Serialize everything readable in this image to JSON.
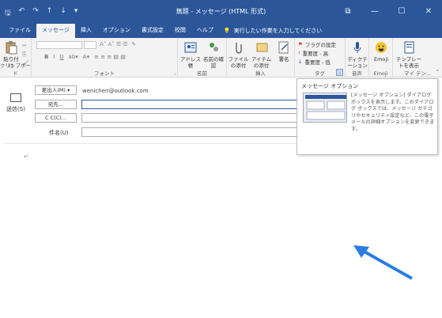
{
  "window": {
    "title": "無題 - メッセージ (HTML 形式)",
    "qa_icons": [
      "save-icon",
      "undo-icon",
      "redo-icon",
      "up-icon",
      "down-icon",
      "more-icon"
    ],
    "controls": {
      "restore": "⧉",
      "minimize": "—",
      "maximize": "☐",
      "close": "✕"
    }
  },
  "tabs": [
    {
      "label": "ファイル",
      "active": false
    },
    {
      "label": "メッセージ",
      "active": true
    },
    {
      "label": "挿入",
      "active": false
    },
    {
      "label": "オプション",
      "active": false
    },
    {
      "label": "書式設定",
      "active": false
    },
    {
      "label": "校閲",
      "active": false
    },
    {
      "label": "ヘルプ",
      "active": false
    }
  ],
  "tellme": "実行したい作業を入力してください",
  "ribbon": {
    "clipboard": {
      "paste": "貼り付け",
      "label": "クリップボード"
    },
    "font": {
      "label": "フォント",
      "bold": "B",
      "italic": "I",
      "underline": "U"
    },
    "names": {
      "address_book": "アドレス帳",
      "check_names": "名前の確認",
      "label": "名前"
    },
    "include": {
      "attach_file": "ファイルの添付",
      "attach_item": "アイテムの添付",
      "signature": "署名",
      "label": "挿入"
    },
    "tags": {
      "followup": "フラグの設定",
      "high": "重要度 - 高",
      "low": "重要度 - 低",
      "label": "タグ"
    },
    "voice": {
      "dictate": "ディクテーション",
      "label": "音声"
    },
    "emoji": {
      "emoji": "Emoji",
      "label": "Emoji"
    },
    "templates": {
      "view": "テンプレートを表示",
      "label": "マイ テン..."
    }
  },
  "tooltip": {
    "title": "メッセージ オプション",
    "desc": "[メッセージ オプション] ダイアログ ボックスを表示します。このダイアログ ボックスでは、メッセージ カテゴリやセキュリティ設定など、この電子メールの詳細オプションを変更できます。"
  },
  "compose": {
    "send": "送信(S)",
    "from_button": "差出人(M) ▾",
    "from_address": "wenichen@outlook.com",
    "to_button": "宛先...",
    "cc_button": "C C(C)...",
    "subject_label": "件名(U)",
    "to_value": "",
    "cc_value": "",
    "subject_value": "",
    "body_mark": "↵"
  },
  "colors": {
    "brand": "#2b579a",
    "arrow": "#2a7de1"
  }
}
